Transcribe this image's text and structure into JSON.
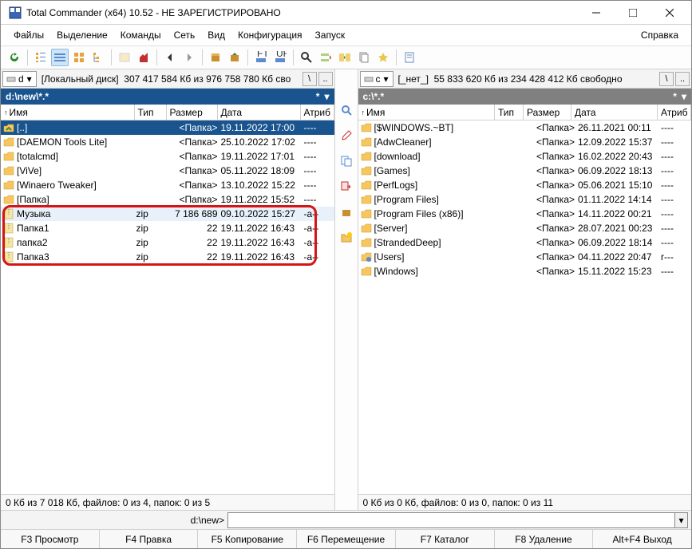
{
  "window": {
    "title": "Total Commander (x64) 10.52 - НЕ ЗАРЕГИСТРИРОВАНО"
  },
  "menu": {
    "file": "Файлы",
    "select": "Выделение",
    "commands": "Команды",
    "net": "Сеть",
    "view": "Вид",
    "config": "Конфигурация",
    "start": "Запуск",
    "help": "Справка"
  },
  "left": {
    "drive_letter": "d",
    "drive_label": "[Локальный диск]",
    "drive_info": "307 417 584 Кб из 976 758 780 Кб сво",
    "path": "d:\\new\\*.*",
    "status": "0 Кб из 7 018 Кб, файлов: 0 из 4, папок: 0 из 5",
    "headers": {
      "name": "Имя",
      "type": "Тип",
      "size": "Размер",
      "date": "Дата",
      "attr": "Атриб"
    },
    "rows": [
      {
        "icon": "up",
        "name": "[..]",
        "type": "",
        "size": "<Папка>",
        "date": "19.11.2022 17:00",
        "attr": "----",
        "sel": true
      },
      {
        "icon": "folder",
        "name": "[DAEMON Tools Lite]",
        "type": "",
        "size": "<Папка>",
        "date": "25.10.2022 17:02",
        "attr": "----"
      },
      {
        "icon": "folder",
        "name": "[totalcmd]",
        "type": "",
        "size": "<Папка>",
        "date": "19.11.2022 17:01",
        "attr": "----"
      },
      {
        "icon": "folder",
        "name": "[ViVe]",
        "type": "",
        "size": "<Папка>",
        "date": "05.11.2022 18:09",
        "attr": "----"
      },
      {
        "icon": "folder",
        "name": "[Winaero Tweaker]",
        "type": "",
        "size": "<Папка>",
        "date": "13.10.2022 15:22",
        "attr": "----"
      },
      {
        "icon": "folder",
        "name": "[Папка]",
        "type": "",
        "size": "<Папка>",
        "date": "19.11.2022 15:52",
        "attr": "----"
      },
      {
        "icon": "zip",
        "name": "Музыка",
        "type": "zip",
        "size": "7 186 689",
        "date": "09.10.2022 15:27",
        "attr": "-a--",
        "hl": true
      },
      {
        "icon": "zip",
        "name": "Папка1",
        "type": "zip",
        "size": "22",
        "date": "19.11.2022 16:43",
        "attr": "-a--"
      },
      {
        "icon": "zip",
        "name": "папка2",
        "type": "zip",
        "size": "22",
        "date": "19.11.2022 16:43",
        "attr": "-a--"
      },
      {
        "icon": "zip",
        "name": "Папка3",
        "type": "zip",
        "size": "22",
        "date": "19.11.2022 16:43",
        "attr": "-a--"
      }
    ]
  },
  "right": {
    "drive_letter": "c",
    "drive_label": "[_нет_]",
    "drive_info": "55 833 620 Кб из 234 428 412 Кб свободно",
    "path": "c:\\*.*",
    "status": "0 Кб из 0 Кб, файлов: 0 из 0, папок: 0 из 11",
    "headers": {
      "name": "Имя",
      "type": "Тип",
      "size": "Размер",
      "date": "Дата",
      "attr": "Атриб"
    },
    "rows": [
      {
        "icon": "folder",
        "name": "[$WINDOWS.~BT]",
        "size": "<Папка>",
        "date": "26.11.2021 00:11",
        "attr": "----"
      },
      {
        "icon": "folder",
        "name": "[AdwCleaner]",
        "size": "<Папка>",
        "date": "12.09.2022 15:37",
        "attr": "----"
      },
      {
        "icon": "folder",
        "name": "[download]",
        "size": "<Папка>",
        "date": "16.02.2022 20:43",
        "attr": "----"
      },
      {
        "icon": "folder",
        "name": "[Games]",
        "size": "<Папка>",
        "date": "06.09.2022 18:13",
        "attr": "----"
      },
      {
        "icon": "folder",
        "name": "[PerfLogs]",
        "size": "<Папка>",
        "date": "05.06.2021 15:10",
        "attr": "----"
      },
      {
        "icon": "folder",
        "name": "[Program Files]",
        "size": "<Папка>",
        "date": "01.11.2022 14:14",
        "attr": "----"
      },
      {
        "icon": "folder",
        "name": "[Program Files (x86)]",
        "size": "<Папка>",
        "date": "14.11.2022 00:21",
        "attr": "----"
      },
      {
        "icon": "folder",
        "name": "[Server]",
        "size": "<Папка>",
        "date": "28.07.2021 00:23",
        "attr": "----"
      },
      {
        "icon": "folder",
        "name": "[StrandedDeep]",
        "size": "<Папка>",
        "date": "06.09.2022 18:14",
        "attr": "----"
      },
      {
        "icon": "folder-u",
        "name": "[Users]",
        "size": "<Папка>",
        "date": "04.11.2022 20:47",
        "attr": "r---"
      },
      {
        "icon": "folder",
        "name": "[Windows]",
        "size": "<Папка>",
        "date": "15.11.2022 15:23",
        "attr": "----"
      }
    ]
  },
  "cmdline": {
    "prompt": "d:\\new>"
  },
  "fnkeys": {
    "f3": "F3 Просмотр",
    "f4": "F4 Правка",
    "f5": "F5 Копирование",
    "f6": "F6 Перемещение",
    "f7": "F7 Каталог",
    "f8": "F8 Удаление",
    "altf4": "Alt+F4 Выход"
  },
  "navbtn": {
    "back": "\\",
    "up": ".."
  }
}
